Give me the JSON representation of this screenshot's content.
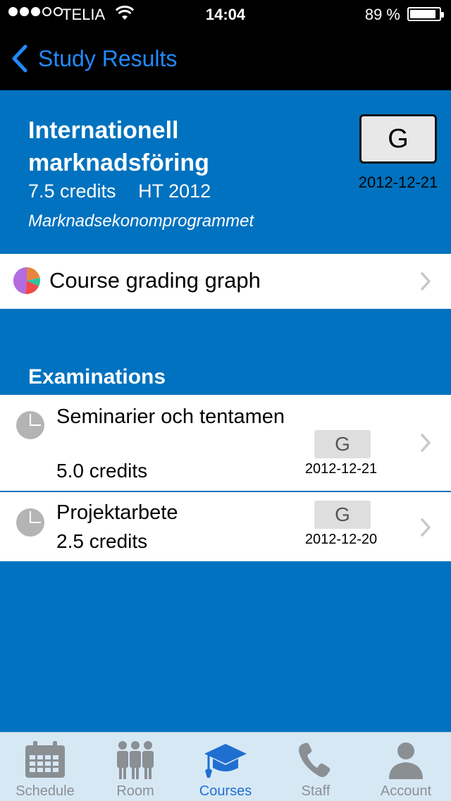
{
  "status_bar": {
    "carrier": "TELIA",
    "time": "14:04",
    "battery_percent": "89 %",
    "battery_level": 0.89,
    "signal_bars": 3,
    "signal_total": 5
  },
  "nav": {
    "back_label": "Study Results"
  },
  "course": {
    "name": "Internationell marknadsföring",
    "credits": "7.5 credits",
    "term": "HT 2012",
    "program": "Marknadsekonomprogrammet",
    "grade": "G",
    "grade_date": "2012-12-21"
  },
  "grading_graph": {
    "label": "Course grading graph"
  },
  "examinations": {
    "title": "Examinations",
    "items": [
      {
        "title": "Seminarier och tentamen",
        "credits": "5.0 credits",
        "grade": "G",
        "date": "2012-12-21"
      },
      {
        "title": "Projektarbete",
        "credits": "2.5 credits",
        "grade": "G",
        "date": "2012-12-20"
      }
    ]
  },
  "tabs": [
    {
      "label": "Schedule",
      "icon": "calendar-icon",
      "active": false
    },
    {
      "label": "Room",
      "icon": "people-icon",
      "active": false
    },
    {
      "label": "Courses",
      "icon": "graduation-cap-icon",
      "active": true
    },
    {
      "label": "Staff",
      "icon": "phone-icon",
      "active": false
    },
    {
      "label": "Account",
      "icon": "person-icon",
      "active": false
    }
  ],
  "colors": {
    "background": "#0072bf",
    "accent": "#1f8bff",
    "tab_active": "#1f6fd1",
    "tab_inactive": "#8a8f94"
  }
}
